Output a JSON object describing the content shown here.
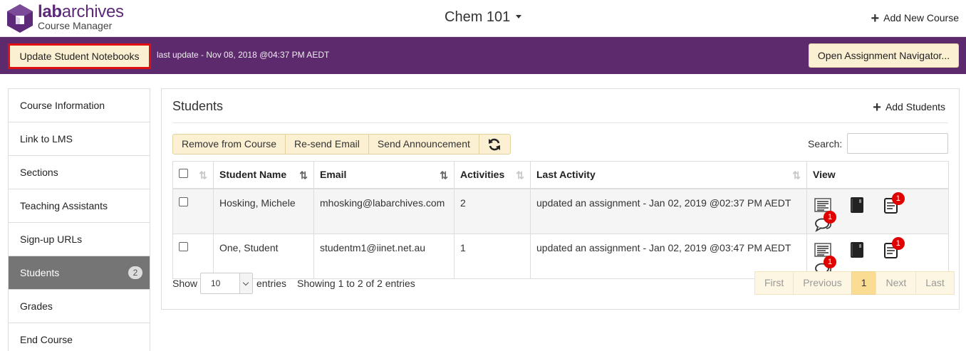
{
  "header": {
    "brand_bold": "lab",
    "brand_rest": "archives",
    "brand_sub": "Course Manager",
    "course_name": "Chem 101",
    "add_course": "Add New Course"
  },
  "toolbar": {
    "update_button": "Update Student Notebooks",
    "last_update": "last update - Nov 08, 2018 @04:37 PM AEDT",
    "navigator_button": "Open Assignment Navigator..."
  },
  "sidebar": {
    "items": [
      {
        "label": "Course Information"
      },
      {
        "label": "Link to LMS"
      },
      {
        "label": "Sections"
      },
      {
        "label": "Teaching Assistants"
      },
      {
        "label": "Sign-up URLs"
      },
      {
        "label": "Students",
        "badge": "2",
        "active": true
      },
      {
        "label": "Grades"
      },
      {
        "label": "End Course"
      }
    ]
  },
  "panel": {
    "title": "Students",
    "add_students": "Add Students",
    "actions": {
      "remove": "Remove from Course",
      "resend": "Re-send Email",
      "announce": "Send Announcement"
    },
    "search_label": "Search:",
    "search_value": ""
  },
  "table": {
    "columns": [
      "Student Name",
      "Email",
      "Activities",
      "Last Activity",
      "View"
    ],
    "rows": [
      {
        "name": "Hosking, Michele",
        "email": "mhosking@labarchives.com",
        "activities": "2",
        "last_activity": "updated an assignment - Jan 02, 2019 @02:37 PM AEDT",
        "notebook_badge": "1",
        "comment_badge": "1"
      },
      {
        "name": "One, Student",
        "email": "studentm1@iinet.net.au",
        "activities": "1",
        "last_activity": "updated an assignment - Jan 02, 2019 @03:47 PM AEDT",
        "notebook_badge": "1",
        "comment_badge": "1"
      }
    ]
  },
  "footer": {
    "show_label": "Show",
    "page_size": "10",
    "entries_label": "entries",
    "info": "Showing 1 to 2 of 2 entries",
    "pager": {
      "first": "First",
      "previous": "Previous",
      "current": "1",
      "next": "Next",
      "last": "Last"
    }
  },
  "colors": {
    "brand": "#5d2a6e",
    "button_bg": "#fcf0d2",
    "badge_red": "#e00000",
    "active_side": "#757575"
  },
  "icons": [
    "labarchives-logo-icon",
    "caret-down-icon",
    "plus-icon",
    "refresh-icon",
    "sort-icon",
    "list-view-icon",
    "notebook-icon",
    "assignment-icon",
    "comments-icon"
  ]
}
